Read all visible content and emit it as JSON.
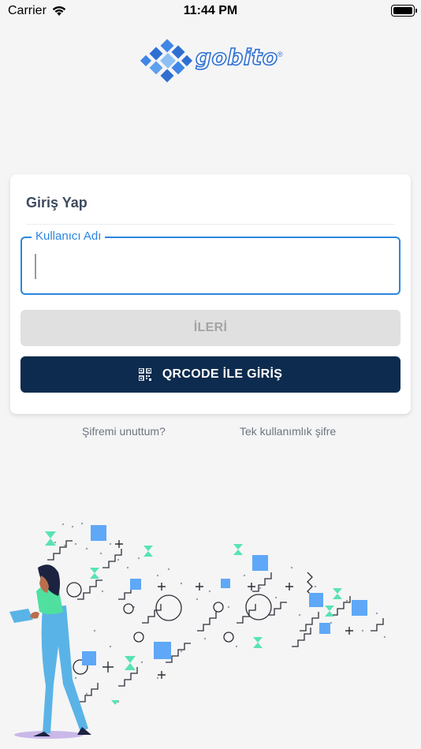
{
  "status_bar": {
    "carrier": "Carrier",
    "time": "11:44 PM"
  },
  "brand": {
    "name": "gobito",
    "registered": "®",
    "primary_color": "#2f6fd1"
  },
  "login": {
    "title": "Giriş Yap",
    "username_label": "Kullanıcı Adı",
    "username_value": "",
    "next_button": "İLERİ",
    "qr_button": "QRCODE İLE GİRİŞ"
  },
  "links": {
    "forgot_password": "Şifremi unuttum?",
    "one_time_password": "Tek kullanımlık şifre"
  },
  "colors": {
    "accent": "#2a86e0",
    "dark_button": "#0d2b4e",
    "disabled_button": "#e0e0e0"
  }
}
